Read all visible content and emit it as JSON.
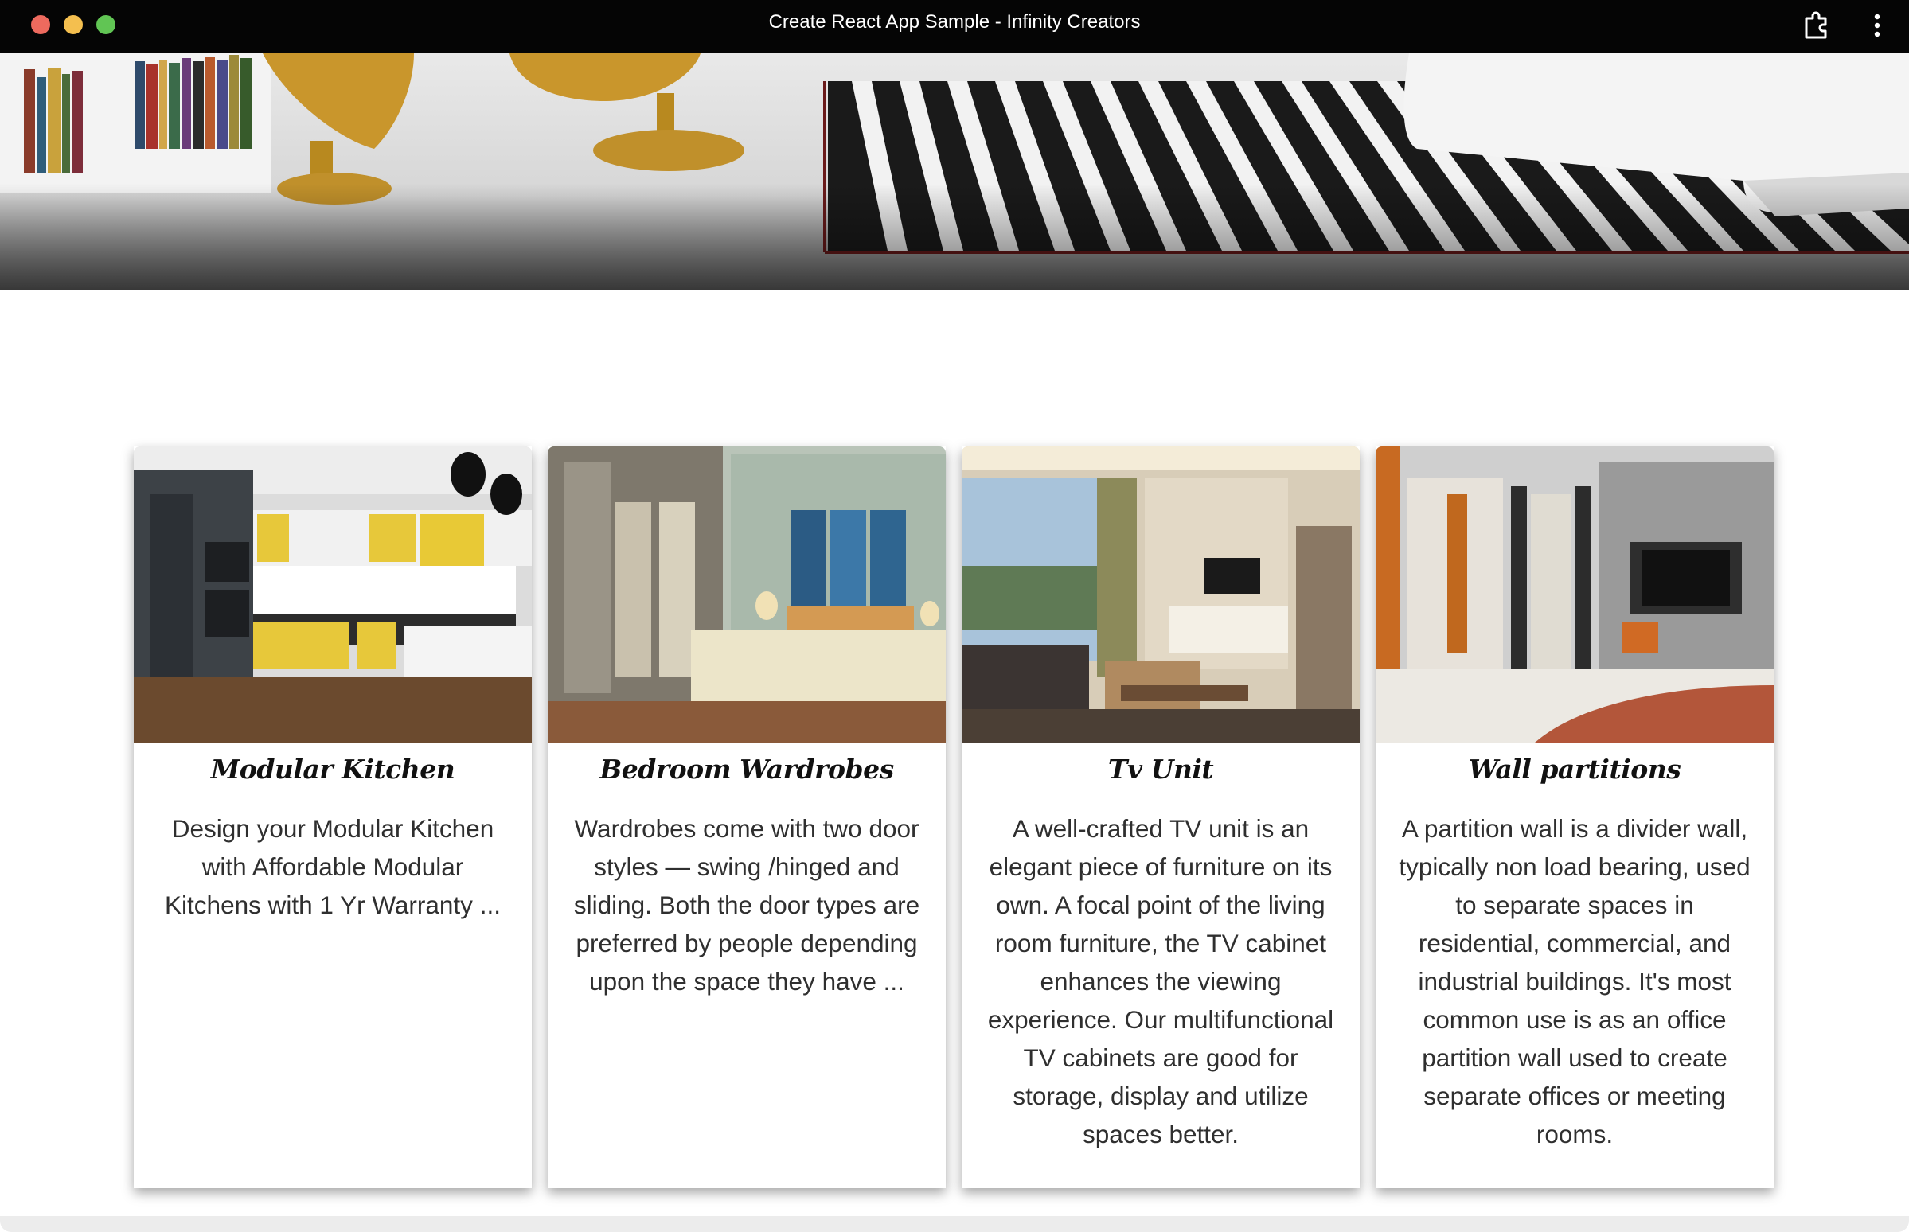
{
  "window": {
    "title": "Create React App Sample - Infinity Creators"
  },
  "icons": {
    "extension": "puzzle-extension-icon",
    "menu": "vertical-ellipsis-icon"
  },
  "hero": {
    "image": "living-room-banner"
  },
  "cards": [
    {
      "title": "Modular Kitchen",
      "image": "modular-kitchen-photo",
      "text": "Design your Modular Kitchen with Affordable Modular Kitchens with 1 Yr Warranty ..."
    },
    {
      "title": "Bedroom Wardrobes",
      "image": "bedroom-wardrobe-photo",
      "text": "Wardrobes come with two door styles — swing /hinged and sliding. Both the door types are preferred by people depending upon the space they have ..."
    },
    {
      "title": "Tv Unit",
      "image": "tv-unit-photo",
      "text": "A well-crafted TV unit is an elegant piece of furniture on its own. A focal point of the living room furniture, the TV cabinet enhances the viewing experience. Our multifunctional TV cabinets are good for storage, display and utilize spaces better."
    },
    {
      "title": "Wall partitions",
      "image": "wall-partition-photo",
      "text": "A partition wall is a divider wall, typically non load bearing, used to separate spaces in residential, commercial, and industrial buildings. It's most common use is as an office partition wall used to create separate offices or meeting rooms."
    }
  ]
}
